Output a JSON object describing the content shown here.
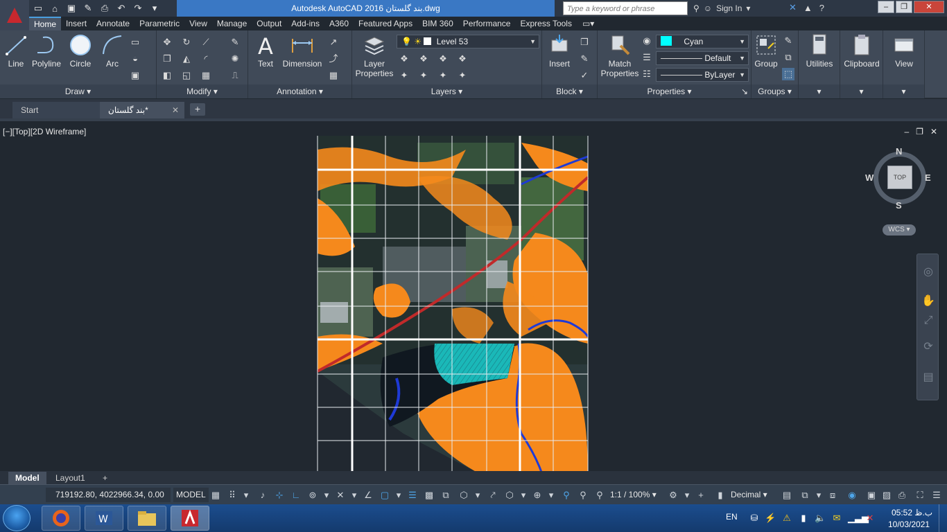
{
  "window": {
    "title": "Autodesk AutoCAD 2016    بند گلستان.dwg",
    "search_placeholder": "Type a keyword or phrase",
    "sign_in": "Sign In"
  },
  "ribbon_tabs": [
    "Home",
    "Insert",
    "Annotate",
    "Parametric",
    "View",
    "Manage",
    "Output",
    "Add-ins",
    "A360",
    "Featured Apps",
    "BIM 360",
    "Performance",
    "Express Tools"
  ],
  "ribbon": {
    "draw": {
      "title": "Draw",
      "line": "Line",
      "polyline": "Polyline",
      "circle": "Circle",
      "arc": "Arc"
    },
    "modify": {
      "title": "Modify"
    },
    "annotation": {
      "title": "Annotation",
      "text": "Text",
      "dimension": "Dimension"
    },
    "layers": {
      "title": "Layers",
      "layer_properties": "Layer Properties",
      "current_layer": "Level 53"
    },
    "block": {
      "title": "Block",
      "insert": "Insert"
    },
    "properties": {
      "title": "Properties",
      "match_properties": "Match Properties",
      "color": "Cyan",
      "linetype": "Default",
      "lineweight": "ByLayer"
    },
    "groups": {
      "title": "Groups",
      "group": "Group"
    },
    "utilities": "Utilities",
    "clipboard": "Clipboard",
    "view": "View"
  },
  "file_tabs": {
    "start": "Start",
    "active": "بند گلستان*"
  },
  "viewport": {
    "label": "[−][Top][2D Wireframe]",
    "viewcube": {
      "n": "N",
      "s": "S",
      "e": "E",
      "w": "W",
      "top": "TOP"
    },
    "wcs": "WCS"
  },
  "layout_tabs": [
    "Model",
    "Layout1"
  ],
  "status": {
    "coords": "719192.80, 4022966.34, 0.00",
    "model": "MODEL",
    "scale": "1:1 / 100%",
    "units": "Decimal"
  },
  "taskbar": {
    "lang": "EN",
    "time": "05:52 ب.ظ",
    "date": "10/03/2021"
  },
  "colors": {
    "accent": "#3a78c4",
    "cyan_layer": "#00ffff",
    "brand_red": "#c8282e"
  }
}
